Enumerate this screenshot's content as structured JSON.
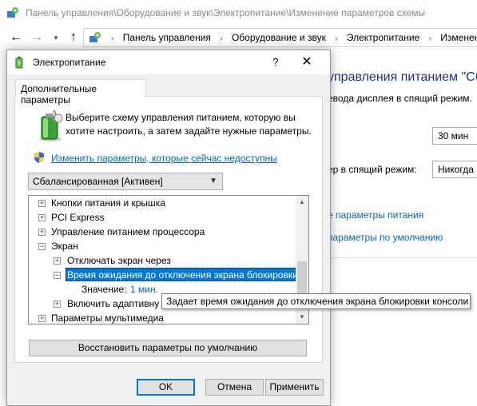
{
  "window": {
    "title": "Панель управления\\Оборудование и звук\\Электропитание\\Изменение параметров схемы",
    "breadcrumbs": [
      "Панель управления",
      "Оборудование и звук",
      "Электропитание",
      "Изменение"
    ]
  },
  "background": {
    "heading": "управления питанием \"Сба",
    "subtitle": "евода дисплея в спящий режим.",
    "display_off_value": "30 мин",
    "sleep_label": "ер в спящий режим:",
    "sleep_value": "Никогда",
    "link_advanced": "е параметры питания",
    "link_defaults": "параметры по умолчанию"
  },
  "dialog": {
    "title": "Электропитание",
    "help_glyph": "?",
    "close_glyph": "✕",
    "tab_label": "Дополнительные параметры",
    "description": "Выберите схему управления питанием, которую вы хотите настроить, а затем задайте нужные параметры.",
    "change_link": "Изменить параметры, которые сейчас недоступны",
    "scheme_selected": "Сбалансированная [Активен]",
    "tree": [
      {
        "label": "Кнопки питания и крышка",
        "level": 0,
        "state": "collapsed"
      },
      {
        "label": "PCI Express",
        "level": 0,
        "state": "collapsed"
      },
      {
        "label": "Управление питанием процессора",
        "level": 0,
        "state": "collapsed"
      },
      {
        "label": "Экран",
        "level": 0,
        "state": "expanded"
      },
      {
        "label": "Отключать экран через",
        "level": 1,
        "state": "collapsed"
      },
      {
        "label": "Время ожидания до отключения экрана блокировки",
        "level": 1,
        "state": "expanded",
        "selected": true
      },
      {
        "label": "Значение:",
        "value": "1 мин.",
        "level": 2
      },
      {
        "label": "Включить адаптивну",
        "level": 1,
        "state": "collapsed"
      },
      {
        "label": "Параметры мультимедиа",
        "level": 0,
        "state": "collapsed"
      }
    ],
    "restore_button": "Восстановить параметры по умолчанию",
    "ok_button": "OK",
    "cancel_button": "Отмена",
    "apply_button": "Применить",
    "tooltip": "Задает время ожидания до отключения экрана блокировки консоли"
  },
  "colors": {
    "accent": "#0078d7",
    "link": "#0066cc",
    "heading": "#1e3287"
  }
}
